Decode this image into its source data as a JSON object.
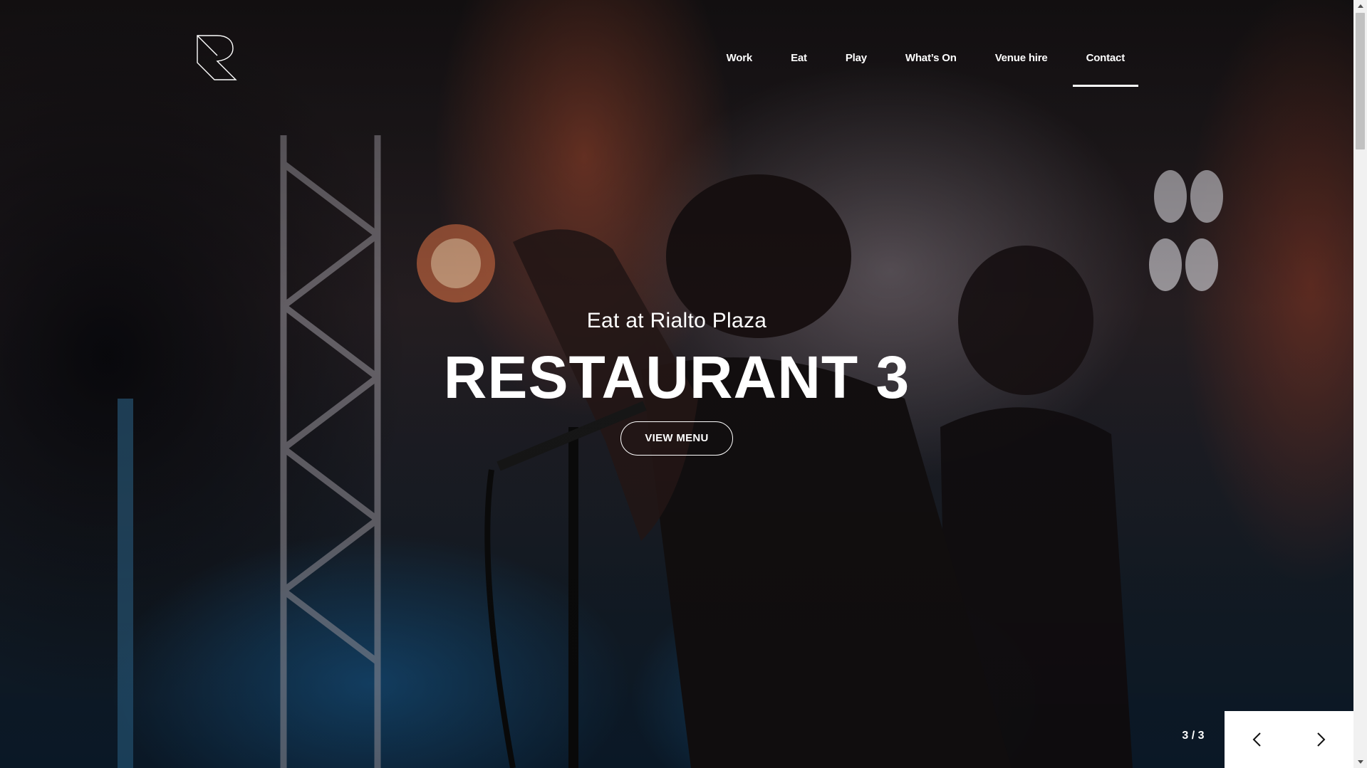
{
  "header": {
    "logo_icon": "r-monogram-logo",
    "nav": [
      {
        "label": "Work",
        "active": false
      },
      {
        "label": "Eat",
        "active": false
      },
      {
        "label": "Play",
        "active": false
      },
      {
        "label": "What’s On",
        "active": false
      },
      {
        "label": "Venue hire",
        "active": false
      },
      {
        "label": "Contact",
        "active": true
      }
    ]
  },
  "hero": {
    "eyebrow": "Eat at Rialto Plaza",
    "title": "RESTAURANT 3",
    "cta_label": "VIEW MENU",
    "background": "live band concert on stage with coloured lights"
  },
  "slider": {
    "counter": "3 / 3",
    "prev_icon": "chevron-left-icon",
    "next_icon": "chevron-right-icon"
  },
  "colors": {
    "text": "#ffffff",
    "control_bg": "#ffffff",
    "control_icon": "#111111"
  }
}
